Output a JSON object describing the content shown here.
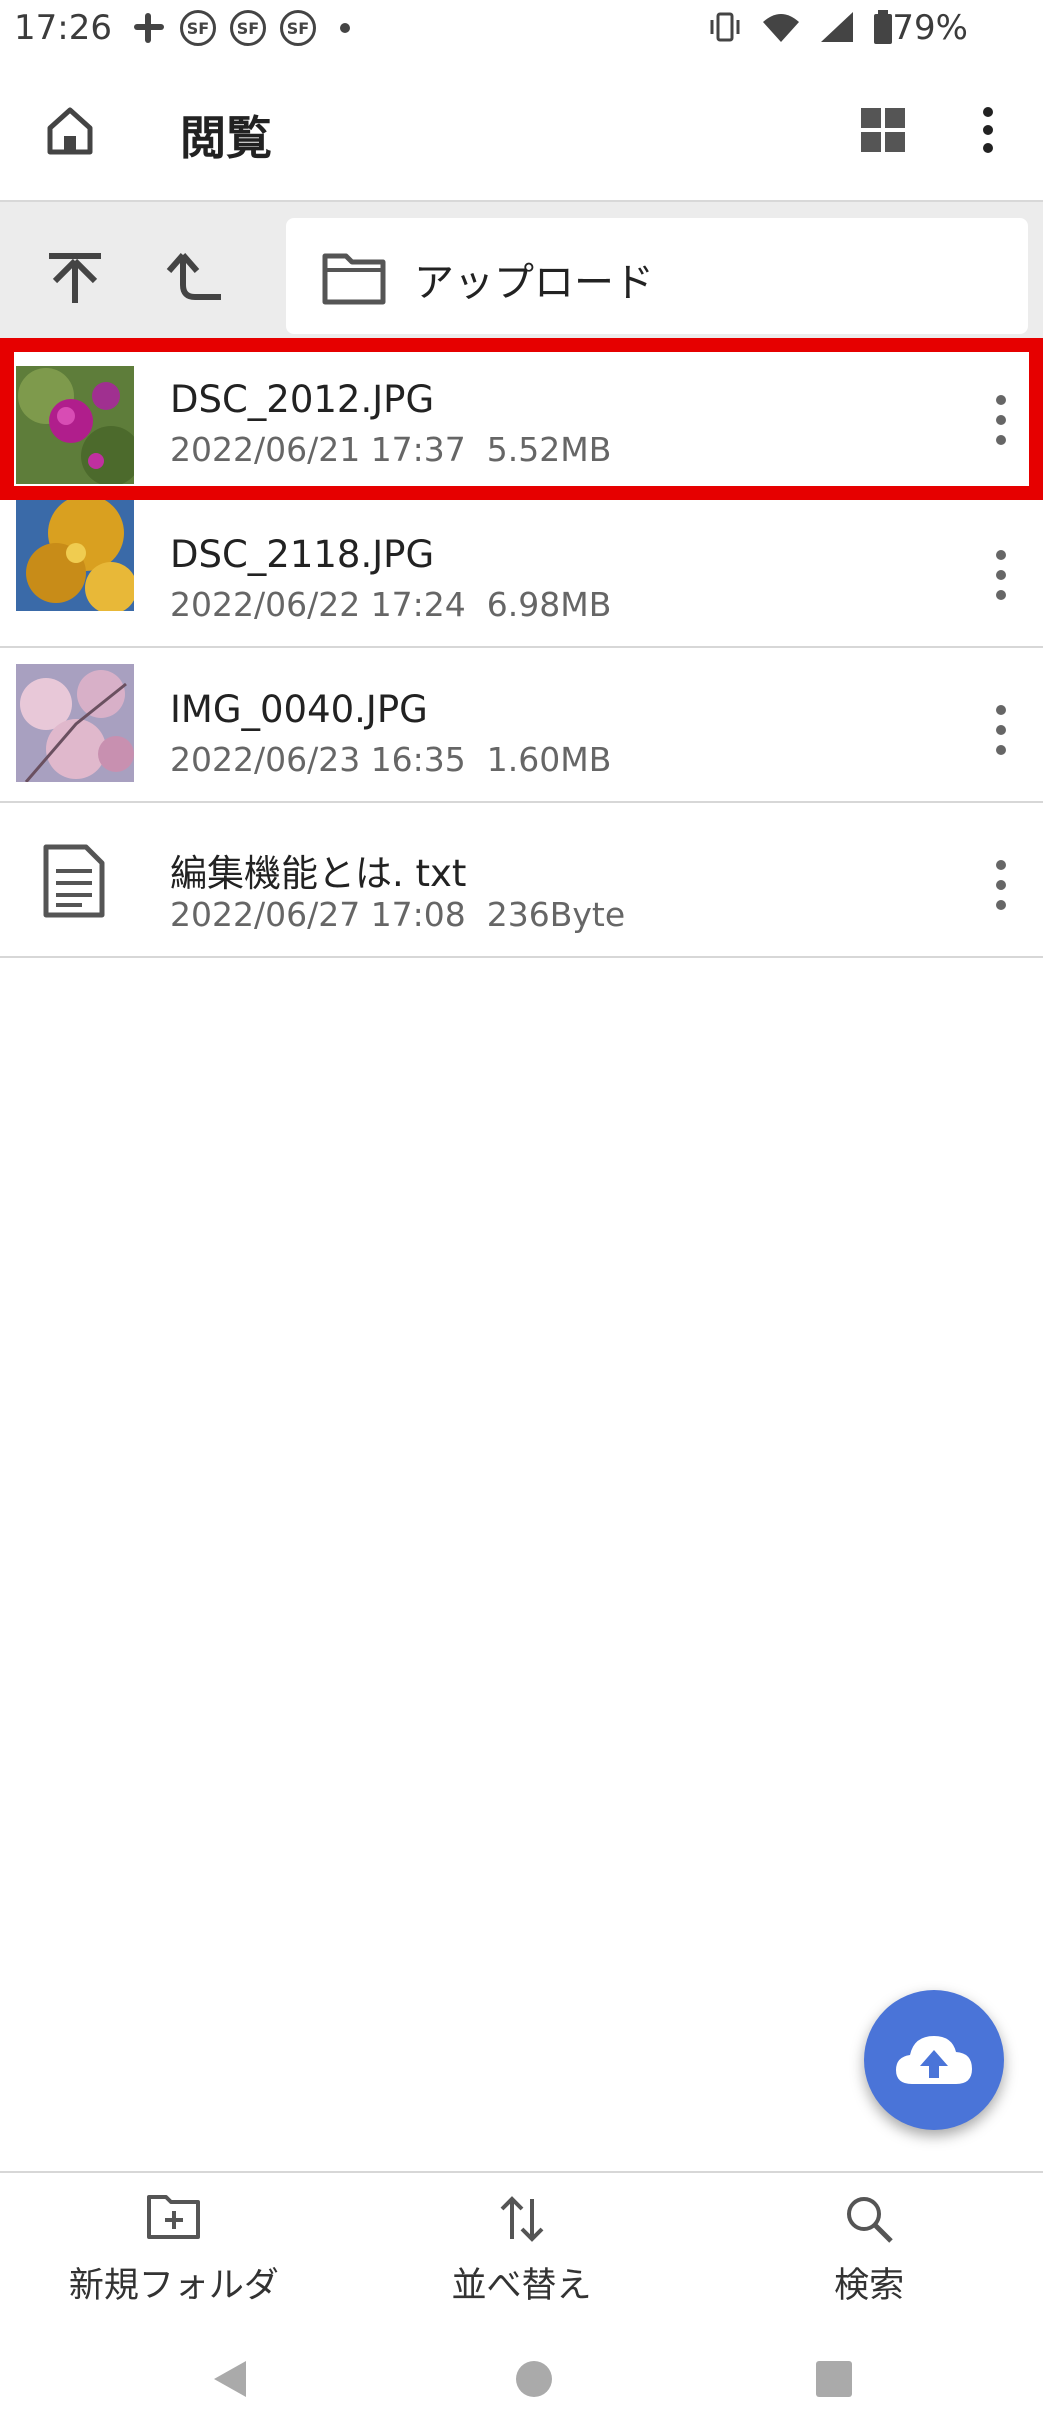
{
  "status_bar": {
    "time": "17:26",
    "notification_icons": [
      "slack-icon",
      "sf-icon",
      "sf-icon",
      "sf-icon",
      "dot-icon"
    ],
    "system_icons": [
      "vibrate-icon",
      "wifi-icon",
      "signal-icon",
      "battery-icon"
    ],
    "battery": "79%"
  },
  "app_bar": {
    "title": "閲覧",
    "home_icon": "home-icon",
    "grid_icon": "grid-view-icon",
    "menu_icon": "more-vert-icon"
  },
  "path_bar": {
    "top_icon": "go-top-icon",
    "up_icon": "go-up-icon",
    "folder_icon": "folder-icon",
    "folder_name": "アップロード"
  },
  "files": [
    {
      "name": "DSC_2012.JPG",
      "datetime": "2022/06/21 17:37",
      "size": "5.52MB",
      "type": "image",
      "selected": true
    },
    {
      "name": "DSC_2118.JPG",
      "datetime": "2022/06/22 17:24",
      "size": "6.98MB",
      "type": "image",
      "selected": false
    },
    {
      "name": "IMG_0040.JPG",
      "datetime": "2022/06/23 16:35",
      "size": "1.60MB",
      "type": "image",
      "selected": false
    },
    {
      "name": "編集機能とは. txt",
      "datetime": "2022/06/27 17:08",
      "size": "236Byte",
      "type": "text",
      "selected": false
    }
  ],
  "fab": {
    "icon": "cloud-upload-icon",
    "color": "#4a74d8"
  },
  "bottom_bar": {
    "new_folder": "新規フォルダ",
    "sort": "並べ替え",
    "search": "検索"
  },
  "colors": {
    "highlight": "#e60000",
    "accent": "#4a74d8"
  }
}
